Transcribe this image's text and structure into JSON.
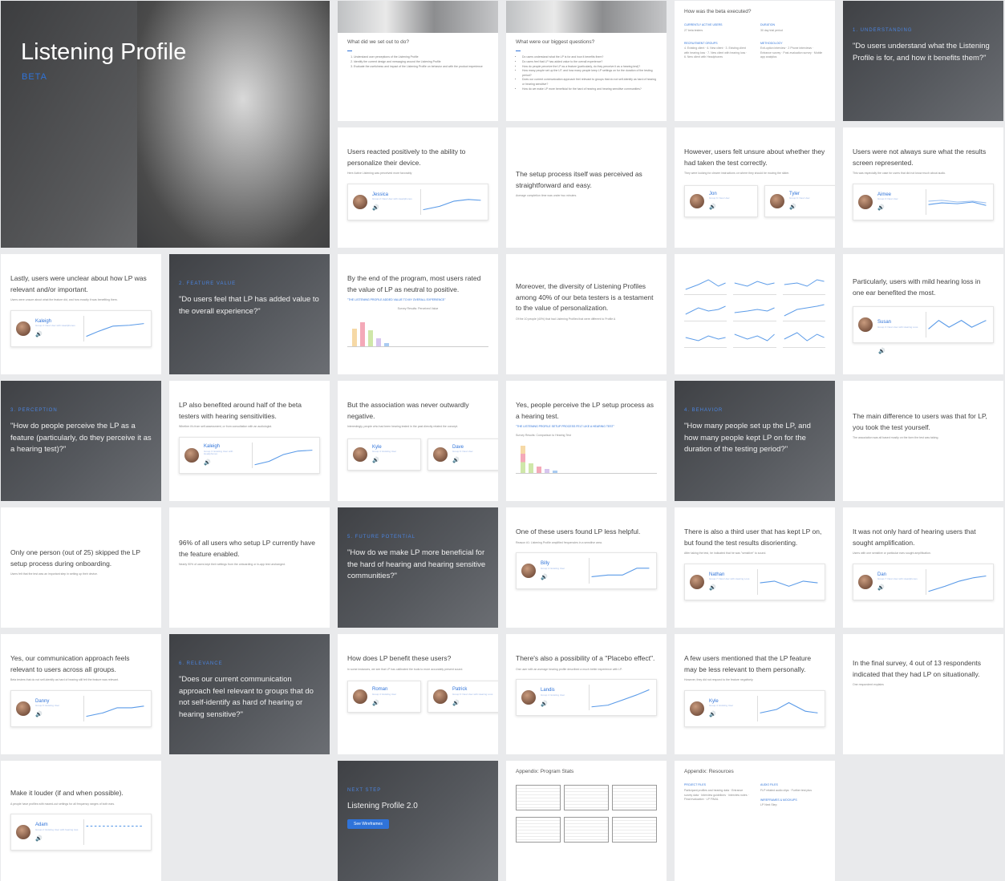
{
  "title_slide": {
    "title": "Listening Profile",
    "tag": "BETA"
  },
  "slides": {
    "s_r1c3": {
      "heading": "What did we set out to do?",
      "items": [
        "Understand user perceptions of the Listening Profile",
        "Identify the current design and messaging around the Listening Profile",
        "Evaluate the usefulness and impact of the Listening Profile on behavior and with the product experience"
      ]
    },
    "s_r1c4": {
      "heading": "What were our biggest questions?",
      "items": [
        "Do users understand what the LP is for and how it benefits them?",
        "Do users feel that LP has added value to the overall experience?",
        "How do people perceive the LP as a feature (particularly, do they perceive it as a hearing test)?",
        "How many people set up the LP, and how many people keep LP settings on for the duration of the testing period?",
        "Does our current communication approach feel relevant to groups that do not self-identify as hard of hearing or hearing sensitive?",
        "How do we make LP more beneficial for the hard of hearing and hearing sensitive communities?"
      ]
    },
    "s_r1c5": {
      "heading": "How was the beta executed?",
      "col1_label": "CURRENTLY ACTIVE USERS",
      "col1_text": "27 beta testers",
      "col2_label": "DURATION",
      "col2_text": "30 day trial period",
      "col3_label": "RECRUITMENT GROUPS",
      "col3_text": "4. Existing client · 6. New client · 3. Existing client with hearing loss · 7. New client with hearing loss · 6. New client with Headphones",
      "col4_label": "METHODOLOGY",
      "col4_text": "Exit-option interview · 2 Phone interviews · Entrance survey · Post-evaluation survey · Mobile app analytics"
    },
    "s_r1c6": {
      "kicker": "1. UNDERSTANDING",
      "quote": "\"Do users understand what the Listening Profile is for, and how it benefits them?\""
    },
    "s_r2c3": {
      "heading": "Users reacted positively to the ability to personalize their device.",
      "sub": "Here Active Listening was perceived more favorably",
      "name": "Jessica",
      "meta": "Group 2: New User with Headphones"
    },
    "s_r2c4": {
      "heading": "The setup process itself was perceived as straightforward and easy.",
      "sub": "Average completion time was under two minutes."
    },
    "s_r2c5": {
      "heading": "However, users felt unsure about whether they had taken the test correctly.",
      "sub": "They were looking for clearer instructions on where they should be moving the slider.",
      "name1": "Jon",
      "meta1": "Group 6: New User",
      "name2": "Tyler",
      "meta2": "Group 6: New User"
    },
    "s_r2c6": {
      "heading": "Users were not always sure what the results screen represented.",
      "sub": "This was especially the case for users that did not know much about audio.",
      "name": "Aimee",
      "meta": "Group 3: New User"
    },
    "s_r3c1": {
      "heading": "Lastly, users were unclear about how LP was relevant and/or important.",
      "sub": "Users were unsure about what the feature did, and how exactly it was benefiting them.",
      "name": "Kaleigh",
      "meta": "Group 3: New User with Headphones"
    },
    "s_r3c2": {
      "kicker": "2. FEATURE VALUE",
      "quote": "\"Do users feel that LP has added value to the overall experience?\""
    },
    "s_r3c3": {
      "heading": "By the end of the program, most users rated the value of LP as neutral to positive.",
      "sub": "\"THE LISTENING PROFILE ADDED VALUE TO MY OVERALL EXPERIENCE\"",
      "chart_title": "Survey Results: Perceived Value"
    },
    "s_r3c4": {
      "heading": "Moreover, the diversity of Listening Profiles among 40% of our beta testers is a testament to the value of personalization.",
      "sub": "Of the 10 people (40%) that had Listening Profiles that were different to Profile A"
    },
    "s_r3c6": {
      "heading": "Particularly, users with mild hearing loss in one ear benefited the most.",
      "name": "Susan",
      "meta": "Group 3: New User with Hearing Loss"
    },
    "s_r4c1": {
      "kicker": "3. PERCEPTION",
      "quote": "\"How do people perceive the LP as a feature (particularly, do they perceive it as a hearing test)?\""
    },
    "s_r4c2": {
      "heading": "LP also benefited around half of the beta testers with hearing sensitivities.",
      "sub": "Whether it's from self-assessment, or from consultation with an audiologist.",
      "name": "Kaleigh",
      "meta": "Group 3: Existing User with Headphones"
    },
    "s_r4c3": {
      "heading": "But the association was never outwardly negative.",
      "sub": "Interestingly, people who had been hearing tested in the past directly related the concept.",
      "name1": "Kyle",
      "meta1": "Group 4: Existing User",
      "name2": "Dave",
      "meta2": "Group 6: New User"
    },
    "s_r4c4": {
      "heading": "Yes, people perceive the LP setup process as a hearing test.",
      "sub": "\"THE LISTENING PROFILE SETUP PROCESS FELT LIKE A HEARING TEST\"",
      "chart_title": "Survey Results: Comparison to Hearing Test"
    },
    "s_r4c5": {
      "kicker": "4. BEHAVIOR",
      "quote": "\"How many people set up the LP, and how many people kept LP on for the duration of the testing period?\""
    },
    "s_r4c6": {
      "heading": "The main difference to users was that for LP, you took the test yourself.",
      "sub": "The association was all based mostly on the form the test was taking."
    },
    "s_r5c1": {
      "heading": "Only one person (out of 25) skipped the LP setup process during onboarding.",
      "sub": "Users felt that the test was an important step in setting up their device."
    },
    "s_r5c2": {
      "heading": "96% of all users who setup LP currently have the feature enabled.",
      "sub": "Nearly 90% of users kept their settings from the onboarding or in-app test unchanged."
    },
    "s_r5c3": {
      "kicker": "5. FUTURE POTENTIAL",
      "quote": "\"How do we make LP more beneficial for the hard of hearing and hearing sensitive communities?\""
    },
    "s_r5c4": {
      "heading": "One of these users found LP less helpful.",
      "sub": "Reason #1: Listening Profile amplified frequencies in a sensitive area.",
      "name": "Billy",
      "meta": "Group 4: Existing User"
    },
    "s_r5c5": {
      "heading": "There is also a third user that has kept LP on, but found the test results disorienting.",
      "sub": "After taking the test, he indicated that he was \"sensitive\" to sound.",
      "name": "Nathan",
      "meta": "Group 7: New User with Hearing Loss"
    },
    "s_r5c6": {
      "heading": "It was not only hard of hearing users that sought amplification.",
      "sub": "Users with one sensitive or particular ears sought amplification.",
      "name": "Dan",
      "meta": "Group 7: New User with Headphones"
    },
    "s_r6c1": {
      "heading": "Yes, our communication approach feels relevant to users across all groups.",
      "sub": "Beta testers that do not self-identify as hard of hearing still felt the feature was relevant.",
      "name": "Danny",
      "meta": "Group 5: Existing User"
    },
    "s_r6c2": {
      "kicker": "6. RELEVANCE",
      "quote": "\"Does our current communication approach feel relevant to groups that do not self-identify as hard of hearing or hearing sensitive?\""
    },
    "s_r6c3": {
      "heading": "How does LP benefit these users?",
      "sub": "In some instances, we see that LP has calibrated the buds to more accurately present sound.",
      "name1": "Roman",
      "meta1": "Group 4: Existing User",
      "name2": "Patrick",
      "meta2": "Group 6: New User with Hearing Loss"
    },
    "s_r6c4": {
      "heading": "There's also a possibility of a \"Placebo effect\".",
      "sub": "One user with an average hearing profile described a much better experience with LP.",
      "name": "Landis",
      "meta": "Group 4: Existing User"
    },
    "s_r6c5": {
      "heading": "A few users mentioned that the LP feature may be less relevant to them personally.",
      "sub": "However, they did not respond to the feature negatively.",
      "name": "Kyle",
      "meta": "Group 4: Existing User"
    },
    "s_r6c6": {
      "heading": "In the final survey, 4 out of 13 respondents indicated that they had LP on situationally.",
      "sub": "One respondent explains"
    },
    "s_r7c1": {
      "heading": "Make it louder (if and when possible).",
      "sub": "A people have profiles with maxed-out settings for all frequency ranges of both ears.",
      "name": "Adam",
      "meta": "Group 2: Existing User with hearing loss"
    },
    "s_r7c3": {
      "kicker": "NEXT STEP",
      "heading": "Listening Profile 2.0",
      "button": "See Wireframes"
    },
    "s_r7c4": {
      "heading": "Appendix: Program Stats"
    },
    "s_r7c5": {
      "heading": "Appendix: Resources",
      "col1_label": "PROJECT FILES",
      "col1_text": "Participant profiles and hearing data · Entrance survey data · Interview guidelines · Interview notes · Final evaluation · LP FINAL",
      "col2_label": "AUDIO FILES",
      "col2_text": "FLP related audio clips · Further test plus",
      "col3_label": "WIREFRAMES & MOCKUPS",
      "col3_text": "LP Next Step"
    }
  },
  "colors": {
    "accent": "#2f73d9",
    "dark_slide": "#4a4c50",
    "speaker": "#e0553f"
  }
}
